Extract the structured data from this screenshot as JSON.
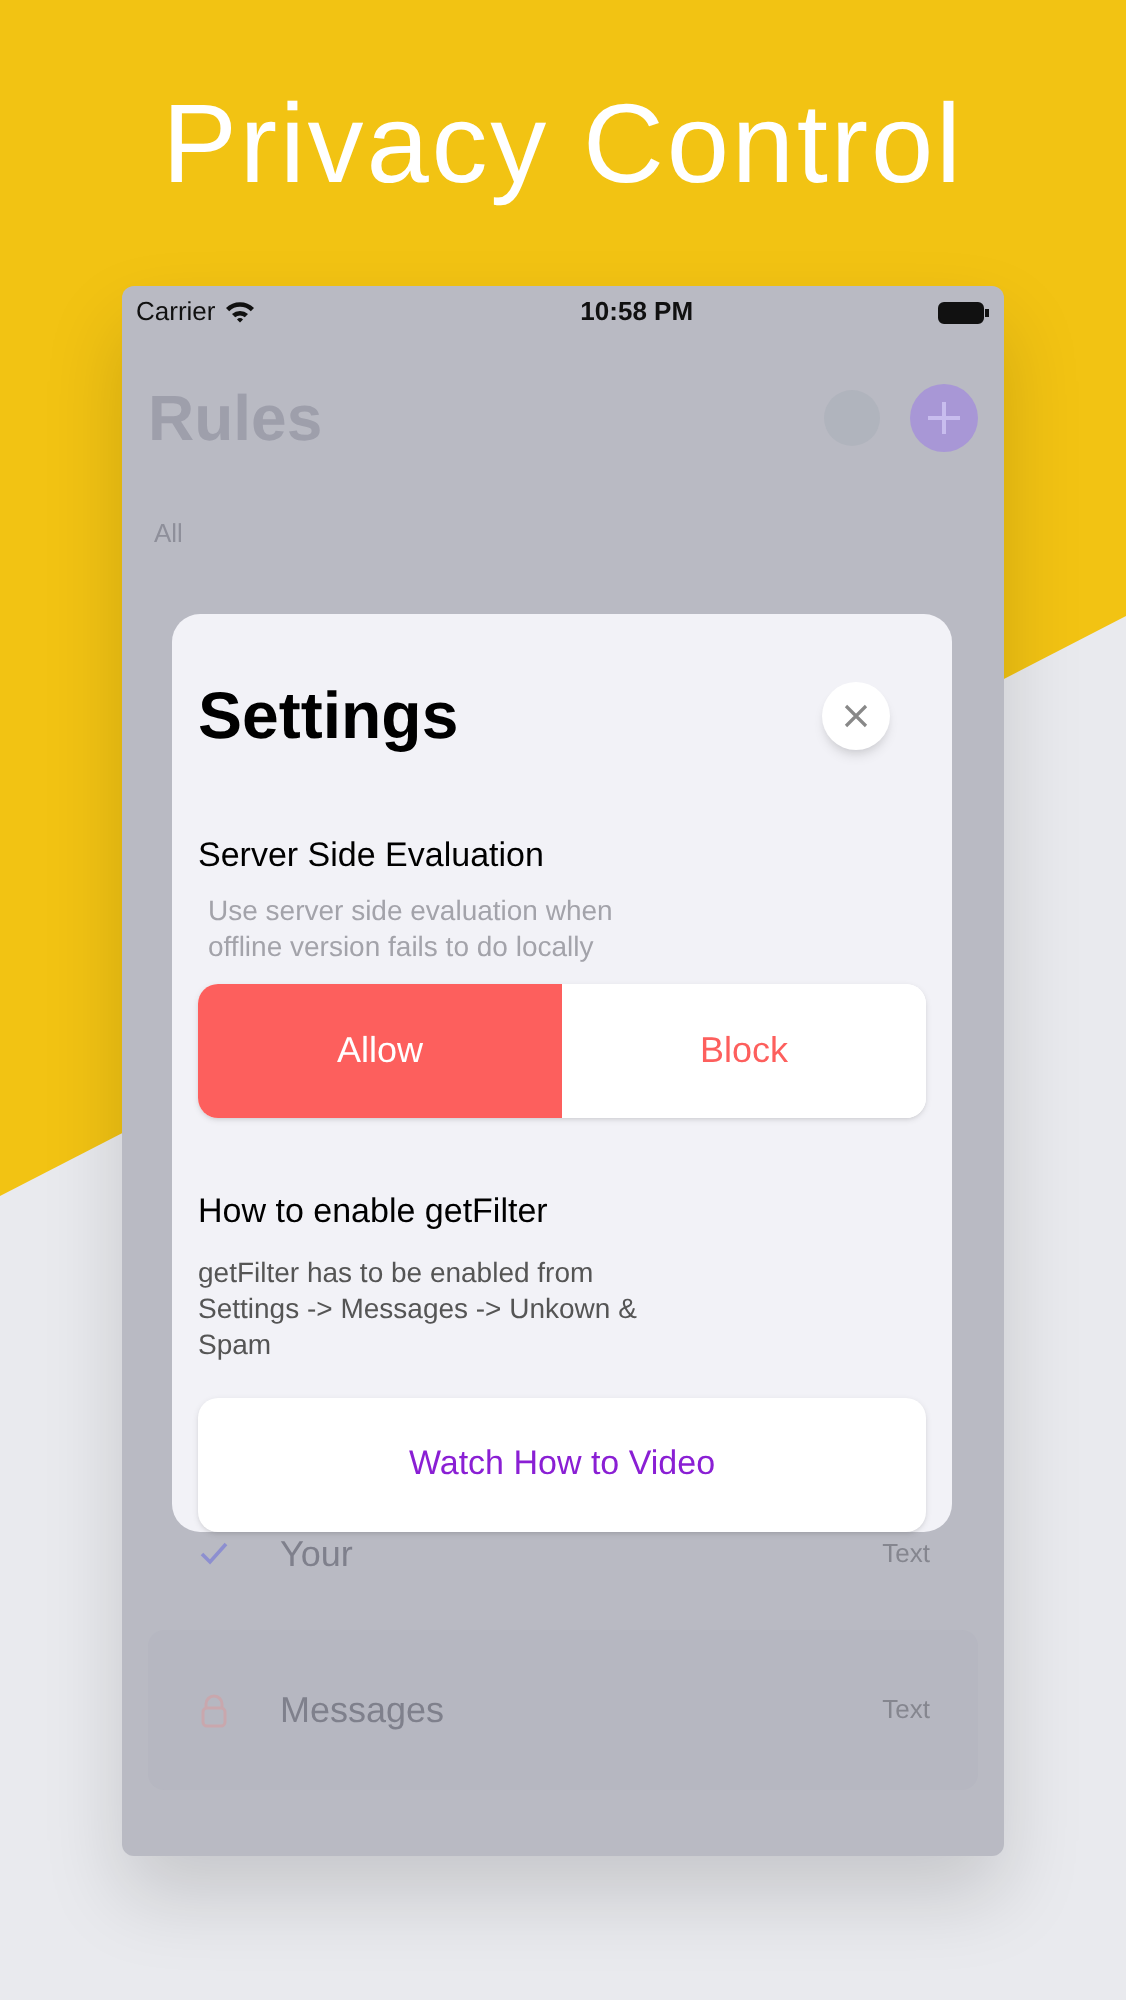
{
  "headline": "Privacy Control",
  "status_bar": {
    "carrier": "Carrier",
    "time": "10:58 PM"
  },
  "screen": {
    "title": "Rules",
    "filters": [
      {
        "label": "All",
        "selected": true
      }
    ],
    "rows": [
      {
        "kind": "check",
        "label": "Your",
        "detail": "Text"
      },
      {
        "kind": "lock",
        "label": "Messages",
        "detail": "Text"
      }
    ]
  },
  "dialog": {
    "title": "Settings",
    "sections": [
      {
        "kind": "segmented",
        "heading": "Server Side Evaluation",
        "description": "Use server side evaluation when offline version fails to do locally",
        "options": [
          {
            "label": "Allow",
            "selected": true
          },
          {
            "label": "Block",
            "selected": false
          }
        ]
      },
      {
        "kind": "button",
        "heading": "How to enable getFilter",
        "description": "getFilter has to be enabled from Settings -> Messages -> Unkown & Spam",
        "button": "Watch How to Video"
      }
    ]
  }
}
